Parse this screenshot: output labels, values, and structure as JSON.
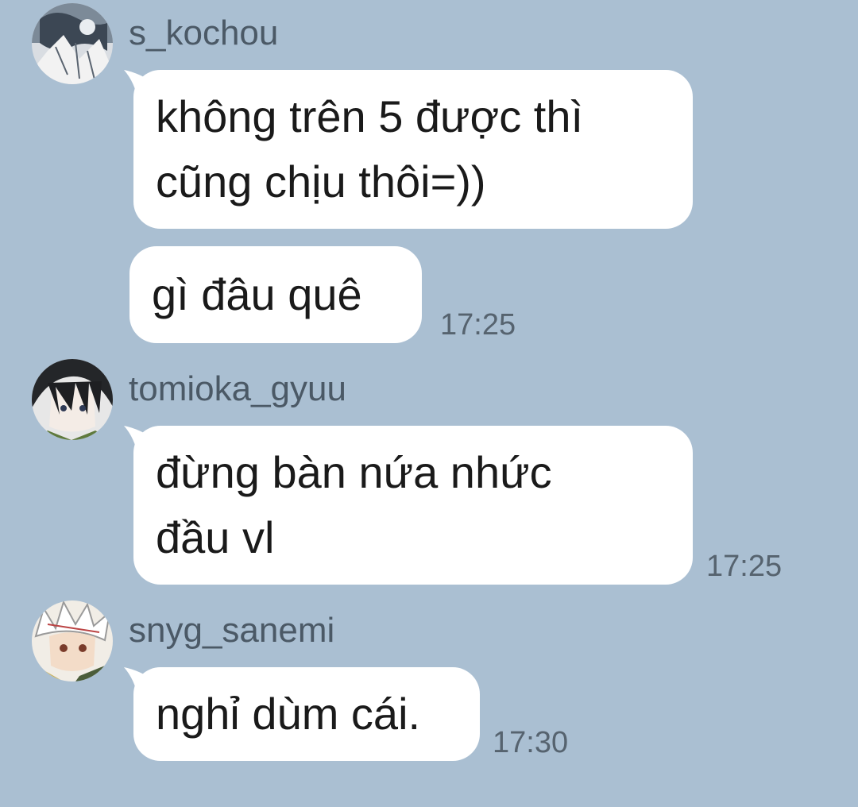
{
  "messages": [
    {
      "username": "s_kochou",
      "avatar": "sketch-character-avatar",
      "bubbles": [
        {
          "lines": [
            "không trên 5 được thì",
            "cũng chịu thôi=))"
          ],
          "time": ""
        },
        {
          "lines": [
            "gì đâu quê"
          ],
          "time": "17:25"
        }
      ]
    },
    {
      "username": "tomioka_gyuu",
      "avatar": "dark-haired-character-avatar",
      "bubbles": [
        {
          "lines": [
            "đừng bàn nứa nhức",
            "đầu vl"
          ],
          "time": "17:25"
        }
      ]
    },
    {
      "username": "snyg_sanemi",
      "avatar": "white-haired-character-avatar",
      "bubbles": [
        {
          "lines": [
            "nghỉ dùm cái."
          ],
          "time": "17:30"
        }
      ]
    }
  ],
  "colors": {
    "background": "#aabfd2",
    "bubble": "#ffffff",
    "username_text": "#4b5966",
    "time_text": "#56636f"
  }
}
